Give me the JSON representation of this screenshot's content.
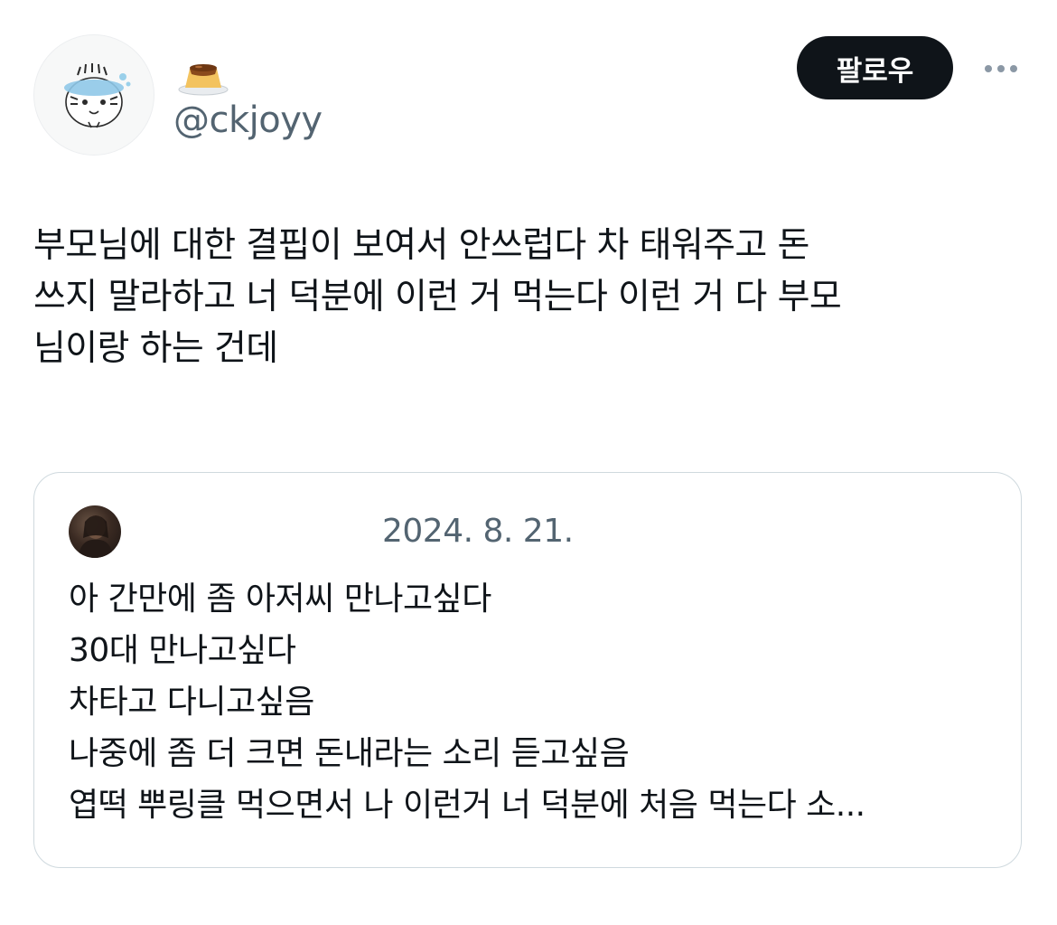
{
  "author": {
    "avatar_icon": "tiger-cartoon-avatar",
    "display_name_icon": "pudding-emoji",
    "handle": "@ckjoyy"
  },
  "actions": {
    "follow_label": "팔로우",
    "more_icon": "more-options-icon"
  },
  "tweet": {
    "text": "부모님에 대한 결핍이 보여서 안쓰럽다 차 태워주고 돈\n쓰지 말라하고 너 덕분에 이런 거 먹는다 이런 거 다 부모\n님이랑 하는 건데"
  },
  "quote": {
    "avatar_icon": "user-photo-avatar",
    "date": "2024. 8. 21.",
    "text": "아 간만에 좀 아저씨 만나고싶다\n30대 만나고싶다\n차타고 다니고싶음\n나중에 좀 더 크면 돈내라는 소리 듣고싶음\n엽떡 뿌링클 먹으면서 나 이런거 너 덕분에 처음 먹는다 소..."
  },
  "colors": {
    "text_primary": "#0f1419",
    "text_secondary": "#536471",
    "border": "#cfd9de",
    "button_bg": "#0f1419",
    "button_fg": "#ffffff"
  }
}
